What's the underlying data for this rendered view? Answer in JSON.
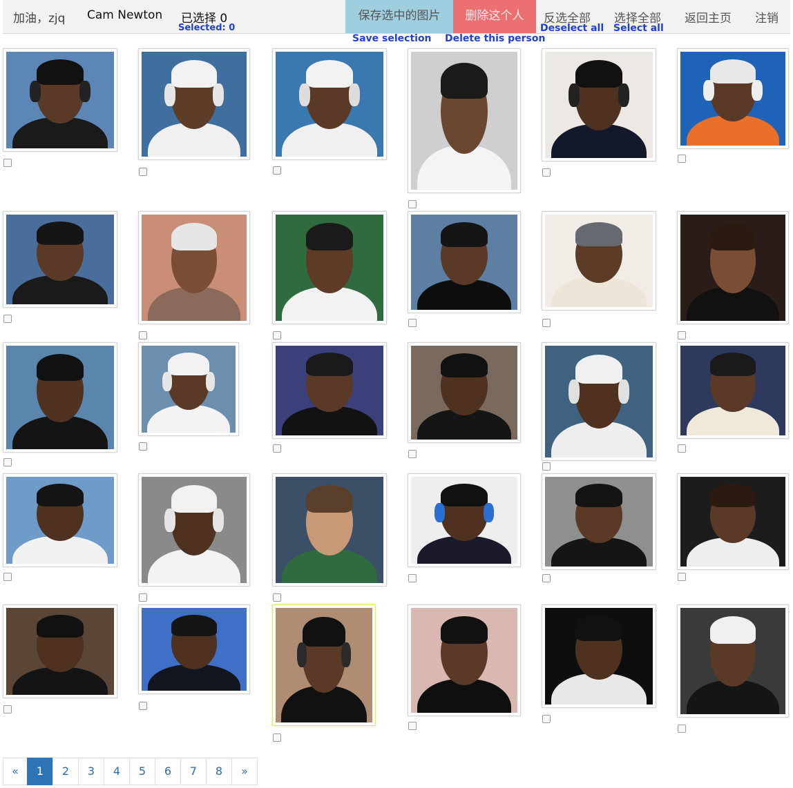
{
  "header": {
    "greeting": "加油，zjq",
    "person_name": "Cam Newton",
    "selected_count_zh": "已选择 0",
    "selected_count_en": "Selected: 0",
    "save_zh": "保存选中的图片",
    "save_en": "Save selection",
    "delete_zh": "删除这个人",
    "delete_en": "Delete this person",
    "deselect_zh": "反选全部",
    "deselect_en": "Deselect all",
    "select_all_zh": "选择全部",
    "select_all_en": "Select all",
    "home_zh": "返回主页",
    "logout_zh": "注销"
  },
  "colors": {
    "save_button": "#9fcfdf",
    "delete_button": "#ec6f72",
    "english_label": "#1f3fd6",
    "active_page": "#2d74b8"
  },
  "photos": [
    {
      "row": 0,
      "col": 0,
      "bg": "#5b86b6",
      "skin": "#5a3a26",
      "cap": "#111111",
      "shirt": "#1a1a1a",
      "phones": "#222222"
    },
    {
      "row": 0,
      "col": 1,
      "bg": "#3f6f9e",
      "skin": "#5e3d28",
      "cap": "#f2f2f2",
      "shirt": "#f0f0f0",
      "phones": "#e6e6e6"
    },
    {
      "row": 0,
      "col": 2,
      "bg": "#3a78b0",
      "skin": "#5a3a26",
      "cap": "#f2f2f2",
      "shirt": "#f0f0f0",
      "phones": "#dddddd"
    },
    {
      "row": 0,
      "col": 3,
      "bg": "#cfcfcf",
      "skin": "#6b4630",
      "cap": "#1a1a1a",
      "shirt": "#f4f4f4",
      "phones": ""
    },
    {
      "row": 0,
      "col": 4,
      "bg": "#ece9e4",
      "skin": "#4e321f",
      "cap": "#111111",
      "shirt": "#14182b",
      "phones": "#222222"
    },
    {
      "row": 0,
      "col": 5,
      "bg": "#1f63b8",
      "skin": "#5a3a26",
      "cap": "#e8e8e8",
      "shirt": "#e8702a",
      "phones": "#eeeeee"
    },
    {
      "row": 1,
      "col": 0,
      "bg": "#4a6e9c",
      "skin": "#5a3a26",
      "cap": "#151515",
      "shirt": "#1a1a1a",
      "phones": ""
    },
    {
      "row": 1,
      "col": 1,
      "bg": "#c98e75",
      "skin": "#7a4d35",
      "cap": "#e6e6e6",
      "shirt": "#8a6a5a",
      "phones": ""
    },
    {
      "row": 1,
      "col": 2,
      "bg": "#2f6b3e",
      "skin": "#5e3b26",
      "cap": "#1a1a1a",
      "shirt": "#f2f2f2",
      "phones": ""
    },
    {
      "row": 1,
      "col": 3,
      "bg": "#5c7fa3",
      "skin": "#5a3a26",
      "cap": "#151515",
      "shirt": "#0e0e0e",
      "phones": ""
    },
    {
      "row": 1,
      "col": 4,
      "bg": "#f1ede6",
      "skin": "#5c3b27",
      "cap": "#666a70",
      "shirt": "#ede6d8",
      "phones": ""
    },
    {
      "row": 1,
      "col": 5,
      "bg": "#2a1c18",
      "skin": "#7a4e34",
      "cap": "#2a1a10",
      "shirt": "#111111",
      "phones": ""
    },
    {
      "row": 2,
      "col": 0,
      "bg": "#5a86ad",
      "skin": "#4f321f",
      "cap": "#111111",
      "shirt": "#141414",
      "phones": ""
    },
    {
      "row": 2,
      "col": 1,
      "bg": "#6c8fb0",
      "skin": "#5a3a26",
      "cap": "#f2f2f2",
      "shirt": "#f3f3f3",
      "phones": "#e6e6e6"
    },
    {
      "row": 2,
      "col": 2,
      "bg": "#3b3f7a",
      "skin": "#5a3a26",
      "cap": "#1a1a1a",
      "shirt": "#121212",
      "phones": ""
    },
    {
      "row": 2,
      "col": 3,
      "bg": "#7a6a5e",
      "skin": "#4e321f",
      "cap": "#111111",
      "shirt": "#151515",
      "phones": ""
    },
    {
      "row": 2,
      "col": 4,
      "bg": "#3f6280",
      "skin": "#4e321f",
      "cap": "#f0f0f0",
      "shirt": "#eeeeee",
      "phones": "#e0e0e0"
    },
    {
      "row": 2,
      "col": 5,
      "bg": "#2d3a5e",
      "skin": "#5a3a26",
      "cap": "#1a1a1a",
      "shirt": "#efe9da",
      "phones": ""
    },
    {
      "row": 3,
      "col": 0,
      "bg": "#6f9bc8",
      "skin": "#4e321f",
      "cap": "#151515",
      "shirt": "#f1f1f1",
      "phones": ""
    },
    {
      "row": 3,
      "col": 1,
      "bg": "#8a8a8a",
      "skin": "#4e321f",
      "cap": "#f2f2f2",
      "shirt": "#f3f3f3",
      "phones": "#e6e6e6"
    },
    {
      "row": 3,
      "col": 2,
      "bg": "#3b4f66",
      "skin": "#c99877",
      "cap": "#5a3f2a",
      "shirt": "#2f6b3f",
      "phones": ""
    },
    {
      "row": 3,
      "col": 3,
      "bg": "#eeeeee",
      "skin": "#4e321f",
      "cap": "#111111",
      "shirt": "#1a1a2a",
      "phones": "#2b6fd1"
    },
    {
      "row": 3,
      "col": 4,
      "bg": "#8f8f8f",
      "skin": "#5a3a26",
      "cap": "#141414",
      "shirt": "#151515",
      "phones": ""
    },
    {
      "row": 3,
      "col": 5,
      "bg": "#1c1c1c",
      "skin": "#5a3a26",
      "cap": "#2a1a10",
      "shirt": "#eeeeee",
      "phones": ""
    },
    {
      "row": 4,
      "col": 0,
      "bg": "#5a4636",
      "skin": "#4e321f",
      "cap": "#111111",
      "shirt": "#141414",
      "phones": ""
    },
    {
      "row": 4,
      "col": 1,
      "bg": "#3f6fc6",
      "skin": "#4e321f",
      "cap": "#151515",
      "shirt": "#13161f",
      "phones": ""
    },
    {
      "row": 4,
      "col": 2,
      "bg": "#b08c72",
      "skin": "#5a3a26",
      "cap": "#111111",
      "shirt": "#111111",
      "phones": "#2a2a2a"
    },
    {
      "row": 4,
      "col": 3,
      "bg": "#d8b8b0",
      "skin": "#5a3a26",
      "cap": "#111111",
      "shirt": "#0f0f0f",
      "phones": ""
    },
    {
      "row": 4,
      "col": 4,
      "bg": "#0e0e0e",
      "skin": "#4e321f",
      "cap": "#111111",
      "shirt": "#e8e8e8",
      "phones": ""
    },
    {
      "row": 4,
      "col": 5,
      "bg": "#3a3a3a",
      "skin": "#5a3a26",
      "cap": "#f0f0f0",
      "shirt": "#151515",
      "phones": ""
    }
  ],
  "pagination": {
    "prev": "«",
    "pages": [
      "1",
      "2",
      "3",
      "4",
      "5",
      "6",
      "7",
      "8"
    ],
    "next": "»",
    "active": "1"
  }
}
